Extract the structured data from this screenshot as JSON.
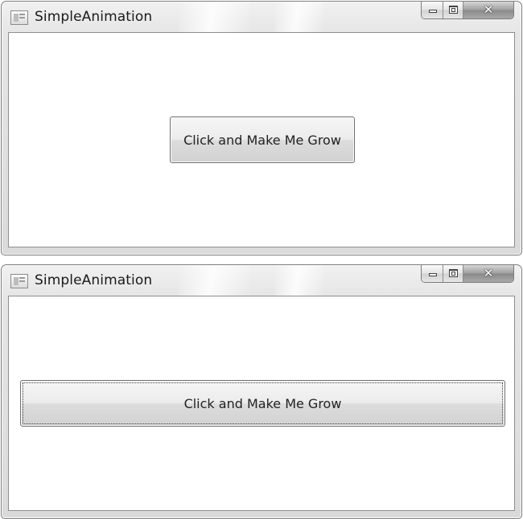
{
  "windows": [
    {
      "title": "SimpleAnimation",
      "button_label": "Click and Make Me Grow",
      "button_state": "initial"
    },
    {
      "title": "SimpleAnimation",
      "button_label": "Click and Make Me Grow",
      "button_state": "grown"
    }
  ],
  "caption_buttons": {
    "minimize_icon": "minimize-icon",
    "maximize_icon": "maximize-icon",
    "close_icon": "close-icon",
    "close_glyph": "✕"
  }
}
